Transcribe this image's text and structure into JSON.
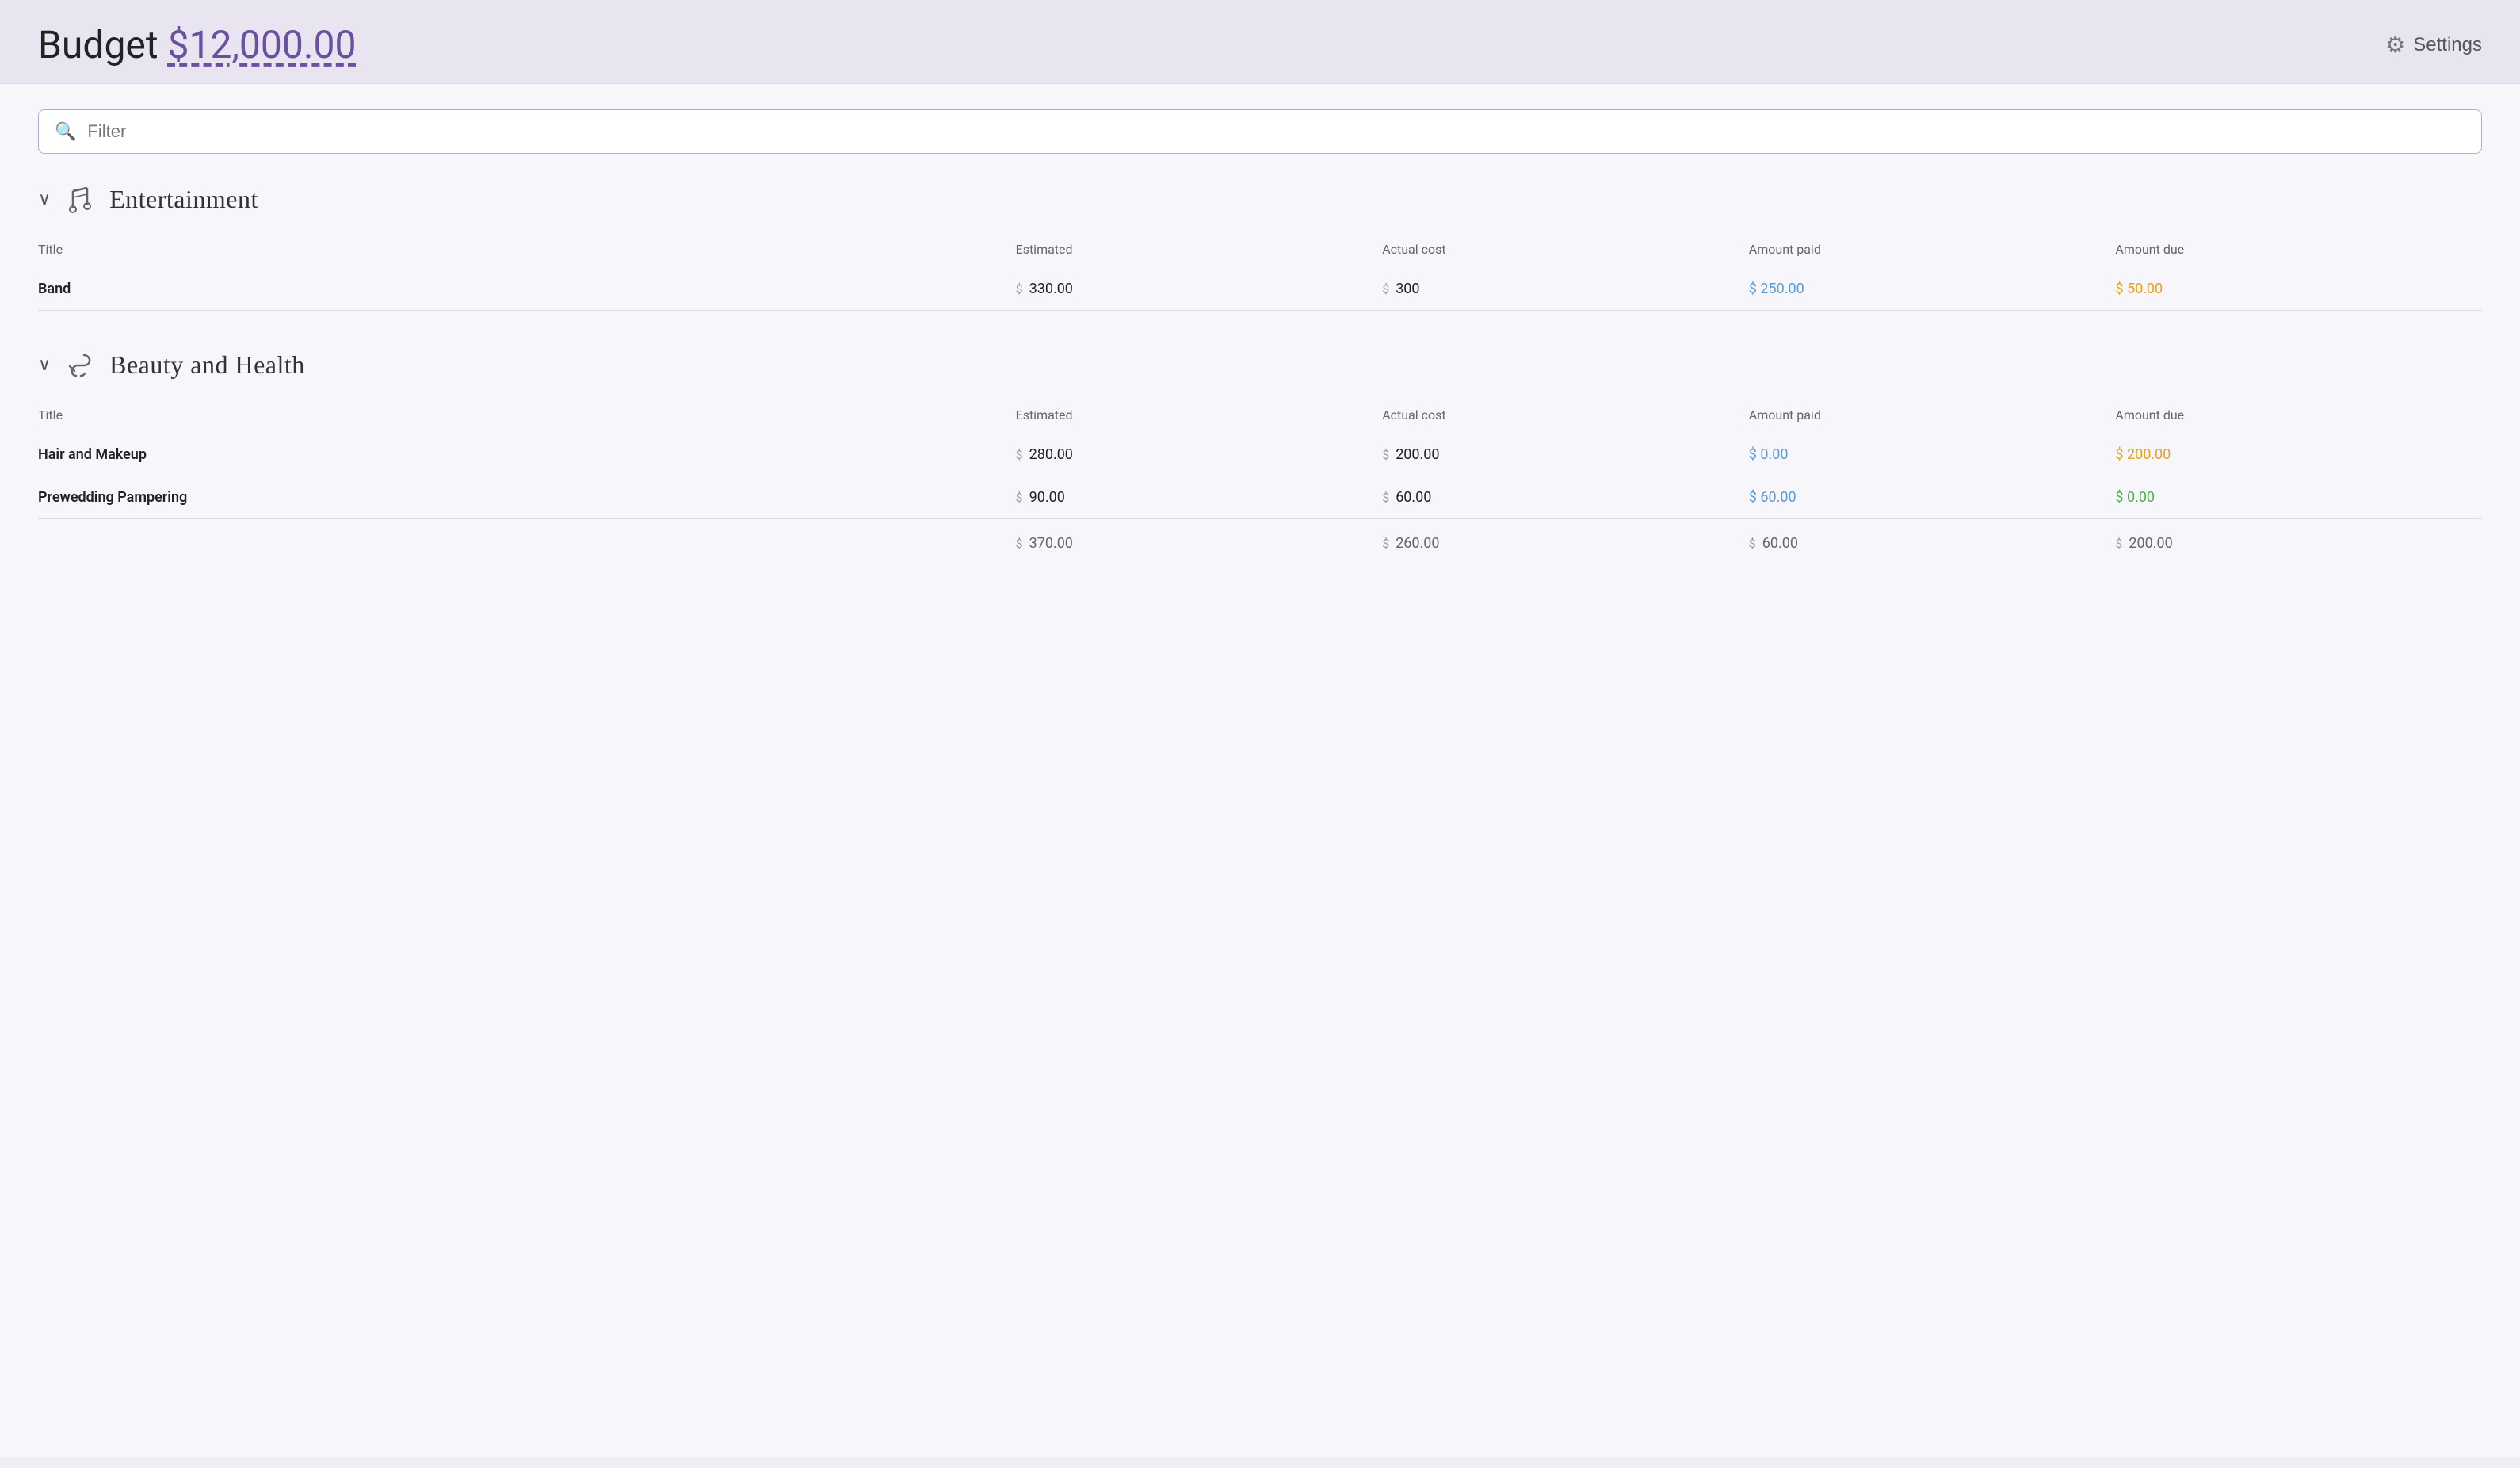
{
  "header": {
    "budget_label": "Budget",
    "budget_amount": "$12,000.00",
    "settings_label": "Settings"
  },
  "filter": {
    "placeholder": "Filter"
  },
  "categories": [
    {
      "id": "entertainment",
      "icon": "♩𝄞",
      "title": "Entertainment",
      "columns": {
        "title": "Title",
        "estimated": "Estimated",
        "actual_cost": "Actual cost",
        "amount_paid": "Amount paid",
        "amount_due": "Amount due"
      },
      "items": [
        {
          "title": "Band",
          "estimated": "330.00",
          "actual_cost": "300",
          "amount_paid": "250.00",
          "amount_due": "50.00",
          "paid_type": "partial",
          "due_type": "nonzero"
        }
      ],
      "subtotal": null
    },
    {
      "id": "beauty-health",
      "icon": "💨",
      "title": "Beauty and Health",
      "columns": {
        "title": "Title",
        "estimated": "Estimated",
        "actual_cost": "Actual cost",
        "amount_paid": "Amount paid",
        "amount_due": "Amount due"
      },
      "items": [
        {
          "title": "Hair and Makeup",
          "estimated": "280.00",
          "actual_cost": "200.00",
          "amount_paid": "0.00",
          "amount_due": "200.00",
          "paid_type": "zero",
          "due_type": "nonzero"
        },
        {
          "title": "Prewedding Pampering",
          "estimated": "90.00",
          "actual_cost": "60.00",
          "amount_paid": "60.00",
          "amount_due": "0.00",
          "paid_type": "partial",
          "due_type": "zero"
        }
      ],
      "subtotal": {
        "estimated": "370.00",
        "actual_cost": "260.00",
        "amount_paid": "60.00",
        "amount_due": "200.00"
      }
    }
  ]
}
